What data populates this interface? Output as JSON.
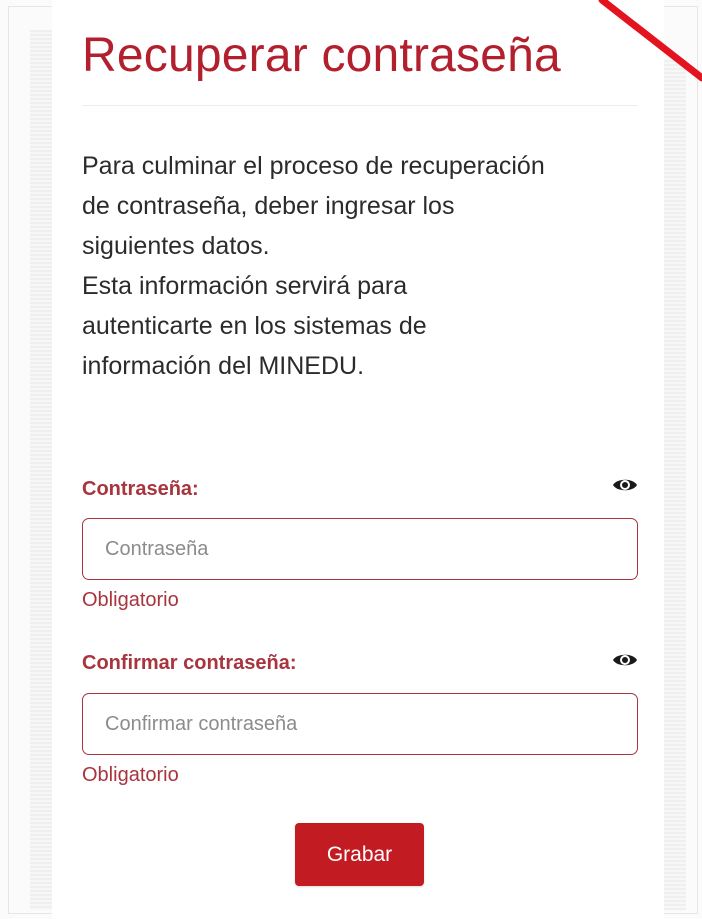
{
  "page": {
    "title": "Recuperar contraseña",
    "intro_lines": [
      "Para culminar el proceso de recuperación",
      "de contraseña, deber ingresar los",
      "siguientes datos.",
      "Esta información servirá para",
      "autenticarte en los sistemas de",
      "información del MINEDU."
    ]
  },
  "form": {
    "password": {
      "label": "Contraseña:",
      "placeholder": "Contraseña",
      "value": "",
      "error": "Obligatorio",
      "toggle_icon": "eye-icon"
    },
    "confirm": {
      "label": "Confirmar contraseña:",
      "placeholder": "Confirmar contraseña",
      "value": "",
      "error": "Obligatorio",
      "toggle_icon": "eye-icon"
    },
    "save_label": "Grabar"
  },
  "colors": {
    "brand_red": "#b21f2d",
    "label_red": "#a8343e",
    "button_red": "#c21b22",
    "text": "#2b2b2b"
  }
}
